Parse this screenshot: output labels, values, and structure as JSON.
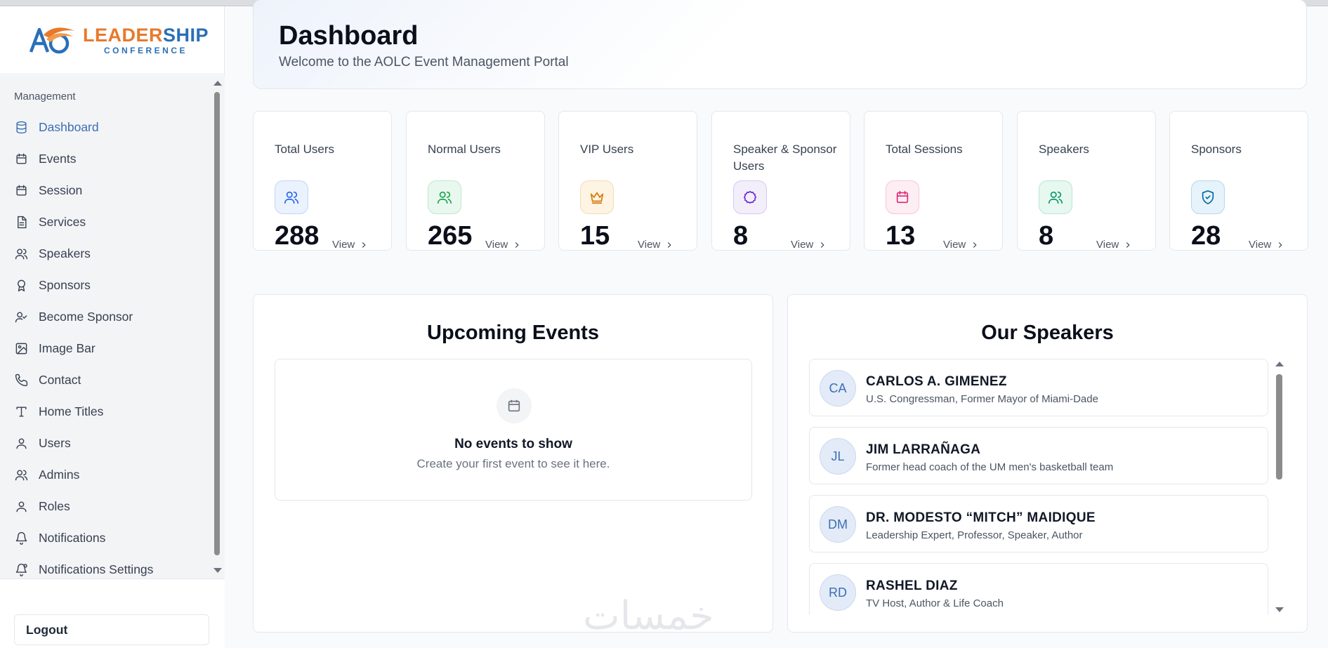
{
  "brand": {
    "logo_main_a": "LEADER",
    "logo_main_b": "SHIP",
    "logo_sub": "CONFERENCE"
  },
  "sidebar": {
    "section_title": "Management",
    "items": [
      {
        "label": "Dashboard",
        "icon": "database-icon",
        "active": true
      },
      {
        "label": "Events",
        "icon": "calendar-icon"
      },
      {
        "label": "Session",
        "icon": "calendar-icon"
      },
      {
        "label": "Services",
        "icon": "document-icon"
      },
      {
        "label": "Speakers",
        "icon": "users-icon"
      },
      {
        "label": "Sponsors",
        "icon": "award-icon"
      },
      {
        "label": "Become Sponsor",
        "icon": "user-check-icon"
      },
      {
        "label": "Image Bar",
        "icon": "image-icon"
      },
      {
        "label": "Contact",
        "icon": "phone-icon"
      },
      {
        "label": "Home Titles",
        "icon": "type-icon"
      },
      {
        "label": "Users",
        "icon": "user-icon"
      },
      {
        "label": "Admins",
        "icon": "users-icon"
      },
      {
        "label": "Roles",
        "icon": "user-icon"
      },
      {
        "label": "Notifications",
        "icon": "bell-icon"
      },
      {
        "label": "Notifications Settings",
        "icon": "bell-settings-icon"
      }
    ],
    "logout_label": "Logout"
  },
  "header": {
    "title": "Dashboard",
    "subtitle": "Welcome to the AOLC Event Management Portal"
  },
  "stats": [
    {
      "label": "Total Users",
      "value": "288",
      "view": "View",
      "icon": "users-icon",
      "color": "#2563eb",
      "bg": "#eaf2fd"
    },
    {
      "label": "Normal Users",
      "value": "265",
      "view": "View",
      "icon": "users-icon",
      "color": "#16a34a",
      "bg": "#e9f8ef"
    },
    {
      "label": "VIP Users",
      "value": "15",
      "view": "View",
      "icon": "crown-icon",
      "color": "#d97706",
      "bg": "#fdf4e3"
    },
    {
      "label": "Speaker & Sponsor Users",
      "value": "8",
      "view": "View",
      "icon": "circle-badge-icon",
      "color": "#6d28d9",
      "bg": "#f2effb"
    },
    {
      "label": "Total Sessions",
      "value": "13",
      "view": "View",
      "icon": "calendar-icon",
      "color": "#db2777",
      "bg": "#fdeef4"
    },
    {
      "label": "Speakers",
      "value": "8",
      "view": "View",
      "icon": "users-icon",
      "color": "#059669",
      "bg": "#e7f8f1"
    },
    {
      "label": "Sponsors",
      "value": "28",
      "view": "View",
      "icon": "shield-check-icon",
      "color": "#0369a1",
      "bg": "#e6f3fb"
    }
  ],
  "events_panel": {
    "title": "Upcoming Events",
    "empty_title": "No events to show",
    "empty_sub": "Create your first event to see it here."
  },
  "speakers_panel": {
    "title": "Our Speakers",
    "speakers": [
      {
        "initials": "CA",
        "name": "CARLOS A. GIMENEZ",
        "title": "U.S. Congressman, Former Mayor of Miami-Dade"
      },
      {
        "initials": "JL",
        "name": "JIM LARRAÑAGA",
        "title": "Former head coach of the UM men's basketball team"
      },
      {
        "initials": "DM",
        "name": "DR. MODESTO “MITCH” MAIDIQUE",
        "title": "Leadership Expert, Professor, Speaker, Author"
      },
      {
        "initials": "RD",
        "name": "RASHEL DIAZ",
        "title": "TV Host, Author & Life Coach"
      }
    ]
  },
  "watermark": "خمسات"
}
